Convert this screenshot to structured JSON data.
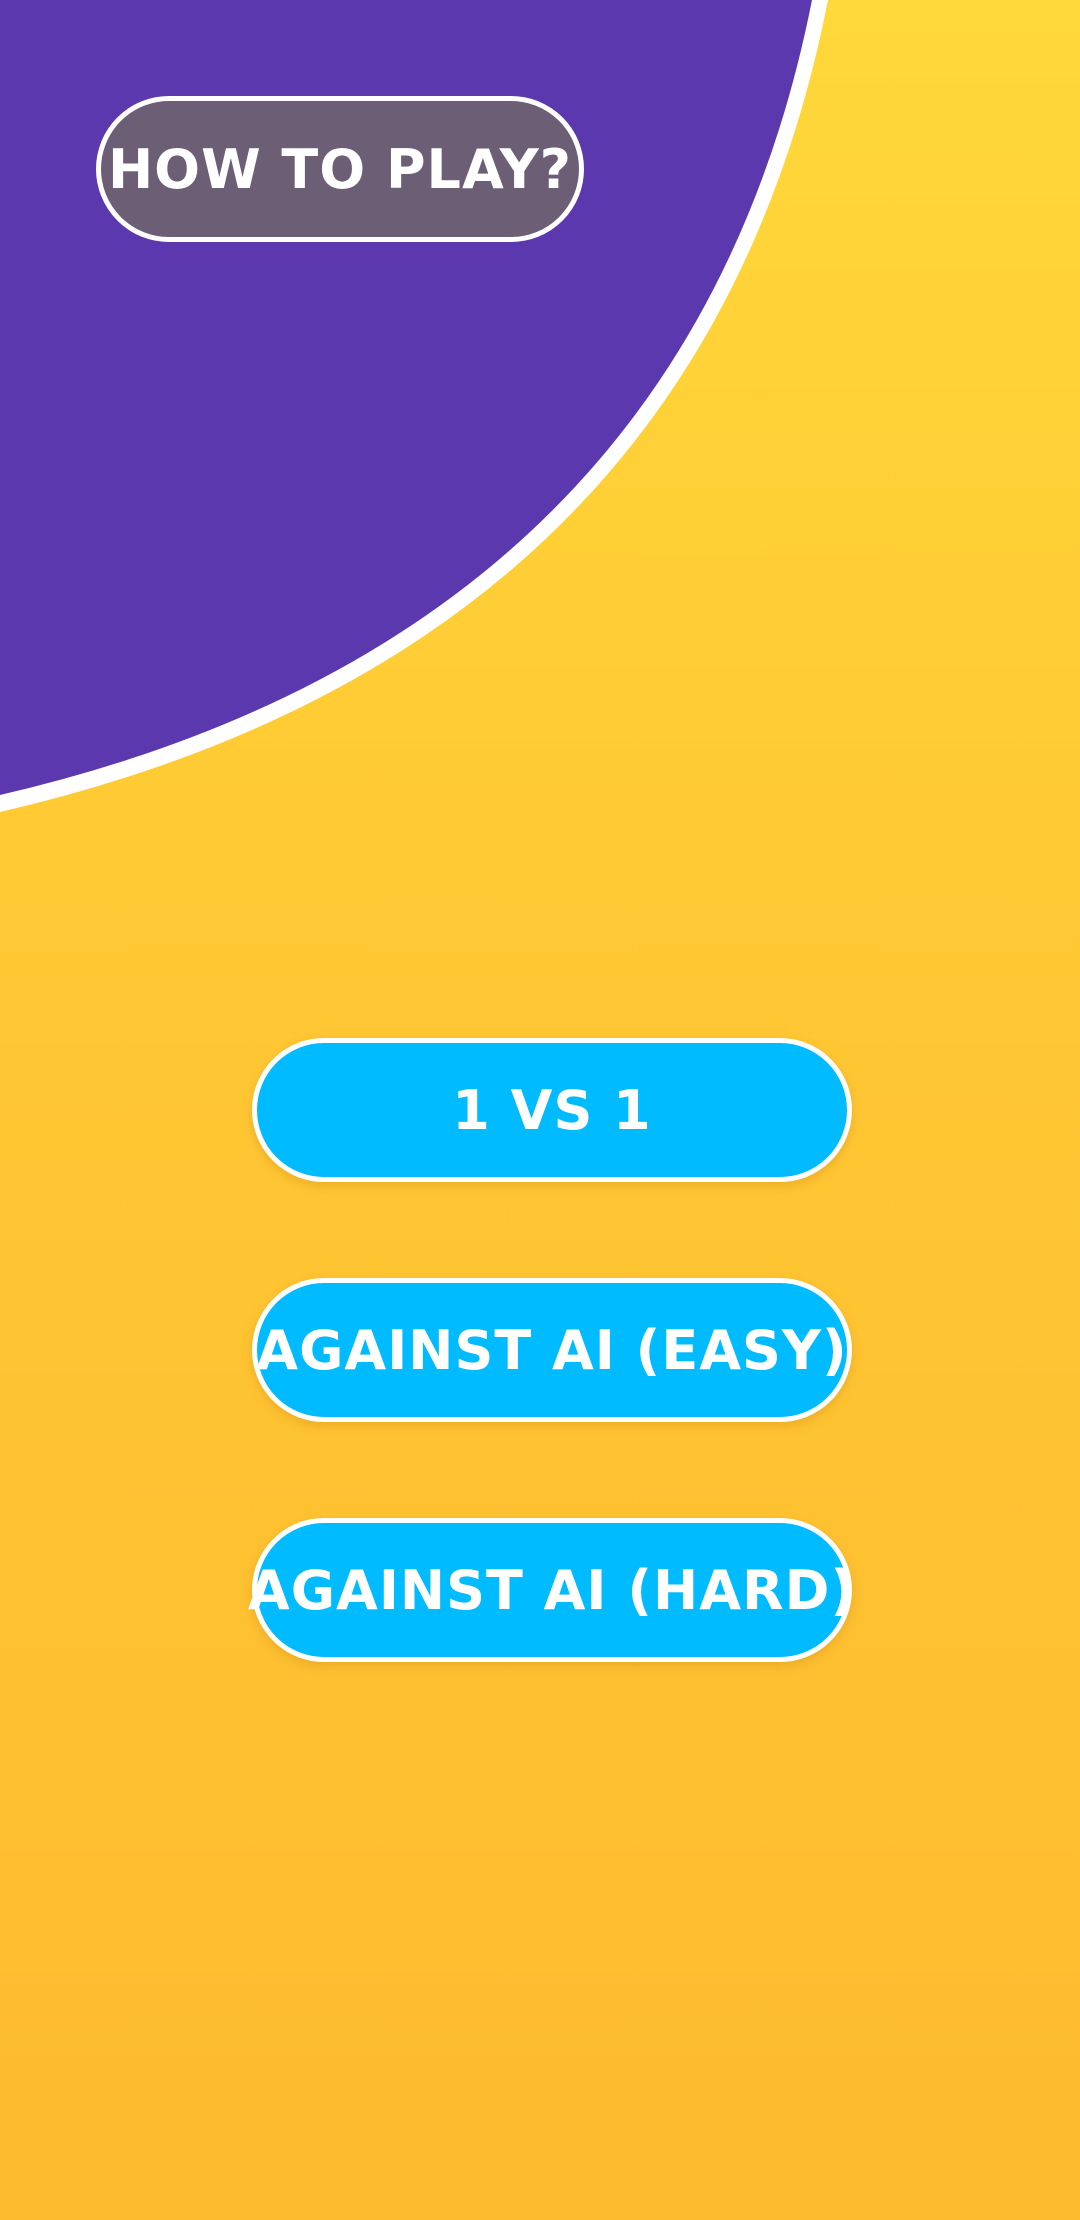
{
  "colors": {
    "background_top": "#FFD83A",
    "background_bottom": "#FDBB2F",
    "purple_panel": "#5C38AE",
    "panel_border": "#FFFFFF",
    "how_to_play_button": "#6B5E75",
    "mode_button": "#00BBFF",
    "button_text": "#FFFFFF"
  },
  "header": {
    "how_to_play_label": "HOW TO PLAY?"
  },
  "modes": [
    {
      "label": "1 VS 1"
    },
    {
      "label": "AGAINST AI (EASY)"
    },
    {
      "label": "AGAINST AI (HARD)"
    }
  ]
}
